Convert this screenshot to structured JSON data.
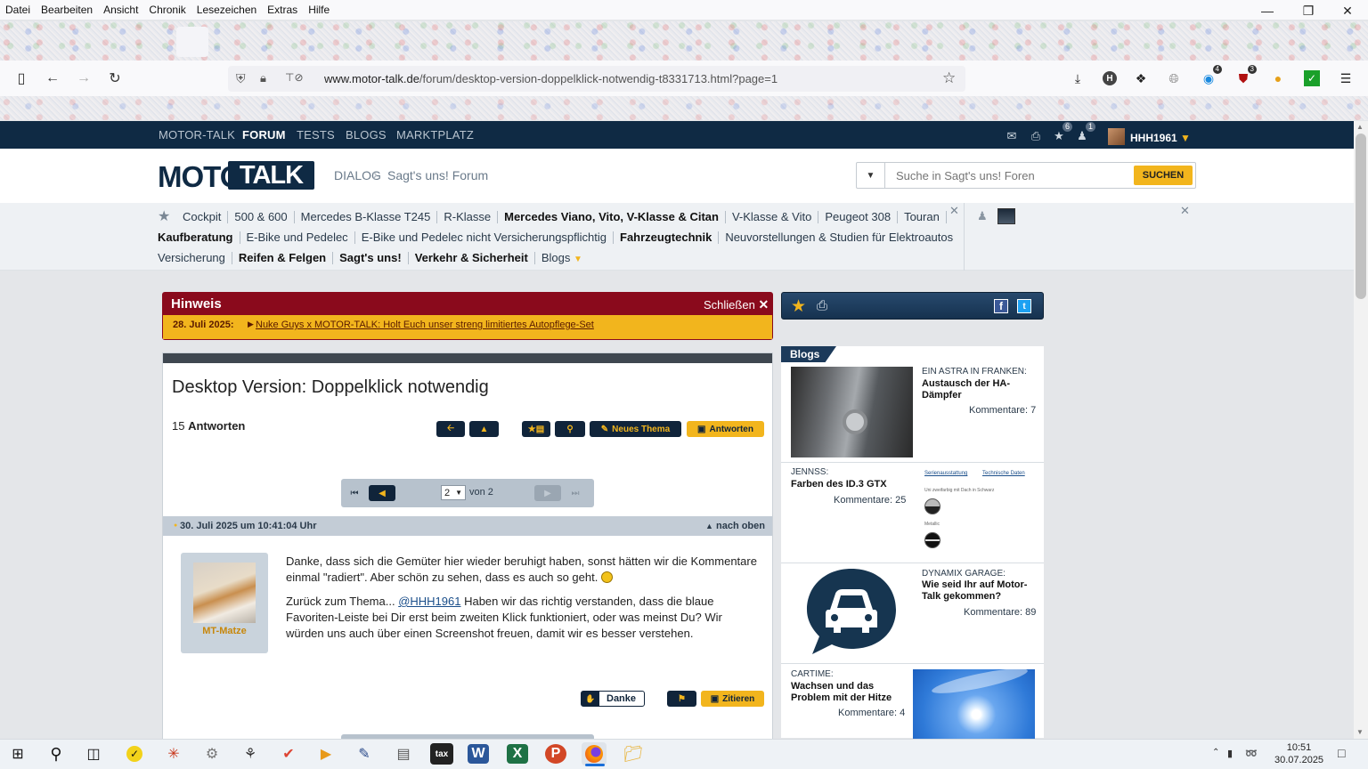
{
  "menubar": {
    "items": [
      "Datei",
      "Bearbeiten",
      "Ansicht",
      "Chronik",
      "Lesezeichen",
      "Extras",
      "Hilfe"
    ]
  },
  "browser": {
    "url_domain": "www.motor-talk.de",
    "url_path": "/forum/desktop-version-doppelklick-notwendig-t8331713.html?page=1",
    "badge_ext1": "4",
    "badge_ext2": "3"
  },
  "site": {
    "topnav": [
      "MOTOR-TALK",
      "FORUM",
      "TESTS",
      "BLOGS",
      "MARKTPLATZ"
    ],
    "badge_favs": "6",
    "badge_friends": "1",
    "username": "HHH1961",
    "logo_motor": "MOTOR",
    "logo_talk": "TALK",
    "crumb_dialog": "DIALOG",
    "crumb_forum": "Sagt's uns! Forum",
    "search_placeholder": "Suche in Sagt's uns! Foren",
    "search_button": "SUCHEN"
  },
  "favorites": {
    "row1": [
      "Cockpit",
      "500 & 600",
      "Mercedes B-Klasse T245",
      "R-Klasse",
      "Mercedes Viano, Vito, V-Klasse & Citan",
      "V-Klasse & Vito",
      "Peugeot 308",
      "Touran"
    ],
    "row2": [
      "Kaufberatung",
      "E-Bike und Pedelec",
      "E-Bike und Pedelec nicht Versicherungspflichtig",
      "Fahrzeugtechnik",
      "Neuvorstellungen & Studien für Elektroautos"
    ],
    "row3": [
      "Versicherung",
      "Reifen & Felgen",
      "Sagt's uns!",
      "Verkehr & Sicherheit",
      "Blogs"
    ]
  },
  "notice": {
    "title": "Hinweis",
    "close": "Schließen",
    "date": "28. Juli 2025:",
    "link": "Nuke Guys x MOTOR-TALK: Holt Euch unser streng limitiertes Autopflege-Set"
  },
  "thread": {
    "title": "Desktop Version: Doppelklick notwendig",
    "answers_count": "15",
    "answers_label": "Antworten",
    "btn_new": "Neues Thema",
    "btn_reply": "Antworten",
    "page_current": "2",
    "page_of": "von 2"
  },
  "post": {
    "date": "30. Juli 2025 um 10:41:04 Uhr",
    "to_top": "nach oben",
    "author": "MT-Matze",
    "p1": "Danke, dass sich die Gemüter hier wieder beruhigt haben, sonst hätten wir die Kommentare einmal \"radiert\". Aber schön zu sehen, dass es auch so geht.",
    "p2_pre": "Zurück zum Thema... ",
    "p2_mention": "@HHH1961",
    "p2_post": " Haben wir das richtig verstanden, dass die blaue Favoriten-Leiste bei Dir erst beim zweiten Klick funktioniert, oder was meinst Du? Wir würden uns auch über einen Screenshot freuen, damit wir es besser verstehen.",
    "thanks": "Danke",
    "quote": "Zitieren"
  },
  "blogs": {
    "tab": "Blogs",
    "items": [
      {
        "author": "EIN ASTRA IN FRANKEN:",
        "title": "Austausch der HA-Dämpfer",
        "comments": "Kommentare: 7"
      },
      {
        "author": "JENNSS:",
        "title": "Farben des ID.3 GTX",
        "comments": "Kommentare: 25",
        "thumb_l1": "Serienausstattung",
        "thumb_l2": "Technische Daten",
        "thumb_l3": "Uni zweifarbig mit Dach in Schwarz",
        "thumb_l4": "Metallic"
      },
      {
        "author": "DYNAMIX GARAGE:",
        "title": "Wie seid Ihr auf Motor-Talk gekommen?",
        "comments": "Kommentare: 89"
      },
      {
        "author": "CARTIME:",
        "title": "Wachsen und das Problem mit der Hitze",
        "comments": "Kommentare: 4"
      }
    ]
  },
  "taskbar": {
    "time": "10:51",
    "date": "30.07.2025"
  }
}
